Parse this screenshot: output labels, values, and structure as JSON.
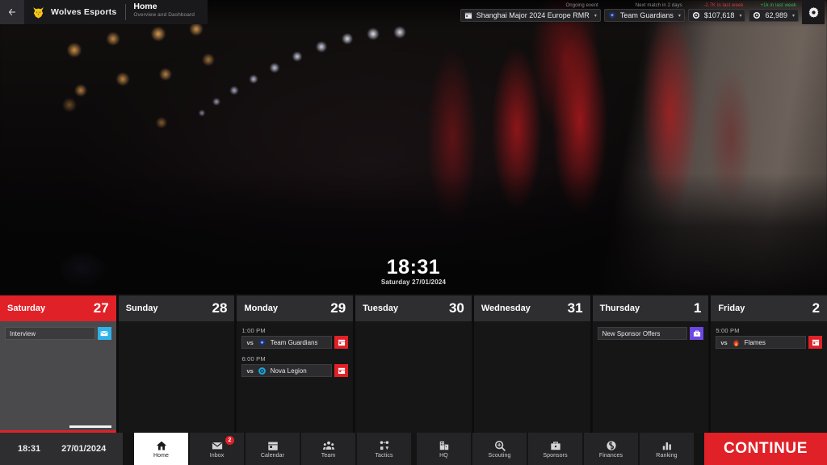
{
  "topbar": {
    "back_icon": "arrow-left-icon",
    "brand": "Wolves Esports",
    "logo_icon": "wolf-head-logo",
    "page_title": "Home",
    "page_subtitle": "Overview and Dashboard",
    "event": {
      "caption": "Ongoing event",
      "icon": "calendar-icon",
      "value": "Shanghai Major 2024 Europe RMR",
      "caret": "▾"
    },
    "next_match": {
      "caption": "Next match in 2 days",
      "icon": "team-guardians-logo",
      "value": "Team Guardians",
      "caret": "▾"
    },
    "money": {
      "caption": "-2.7K in last week",
      "trend": "negative",
      "icon": "coin-icon",
      "value": "$107,618",
      "caret": "▾"
    },
    "fans": {
      "caption": "+1k in last week",
      "trend": "positive",
      "icon": "coin-icon",
      "value": "62,989",
      "caret": "▾"
    },
    "settings_icon": "gear-icon"
  },
  "clock": {
    "time": "18:31",
    "date": "Saturday 27/01/2024"
  },
  "calendar": {
    "days": [
      {
        "name": "Saturday",
        "number": "27",
        "today": true,
        "progress": true,
        "events": [
          {
            "time": "",
            "vs": "",
            "label": "Interview",
            "icon": "",
            "action_icon": "envelope-icon",
            "action_color": "blue"
          }
        ]
      },
      {
        "name": "Sunday",
        "number": "28",
        "today": false,
        "progress": false,
        "events": []
      },
      {
        "name": "Monday",
        "number": "29",
        "today": false,
        "progress": false,
        "events": [
          {
            "time": "1:00 PM",
            "vs": "vs",
            "label": "Team Guardians",
            "icon": "team-guardians-logo",
            "action_icon": "calendar-icon",
            "action_color": "red"
          },
          {
            "time": "6:00 PM",
            "vs": "vs",
            "label": "Nova Legion",
            "icon": "nova-legion-logo",
            "action_icon": "calendar-icon",
            "action_color": "red"
          }
        ]
      },
      {
        "name": "Tuesday",
        "number": "30",
        "today": false,
        "progress": false,
        "events": []
      },
      {
        "name": "Wednesday",
        "number": "31",
        "today": false,
        "progress": false,
        "events": []
      },
      {
        "name": "Thursday",
        "number": "1",
        "today": false,
        "progress": false,
        "events": [
          {
            "time": "",
            "vs": "",
            "label": "New Sponsor Offers",
            "icon": "",
            "action_icon": "briefcase-icon",
            "action_color": "purple"
          }
        ]
      },
      {
        "name": "Friday",
        "number": "2",
        "today": false,
        "progress": false,
        "events": [
          {
            "time": "5:00 PM",
            "vs": "vs",
            "label": "Flames",
            "icon": "flames-logo",
            "action_icon": "calendar-icon",
            "action_color": "red"
          }
        ]
      }
    ]
  },
  "bottom": {
    "time": "18:31",
    "date": "27/01/2024",
    "nav": [
      {
        "label": "Home",
        "icon": "home-icon",
        "active": true,
        "badge": ""
      },
      {
        "label": "Inbox",
        "icon": "envelope-icon",
        "active": false,
        "badge": "2"
      },
      {
        "label": "Calendar",
        "icon": "calendar-icon",
        "active": false,
        "badge": ""
      },
      {
        "label": "Team",
        "icon": "people-icon",
        "active": false,
        "badge": ""
      },
      {
        "label": "Tactics",
        "icon": "tactics-icon",
        "active": false,
        "badge": ""
      },
      {
        "label": "HQ",
        "icon": "building-icon",
        "active": false,
        "badge": ""
      },
      {
        "label": "Scouting",
        "icon": "search-icon",
        "active": false,
        "badge": ""
      },
      {
        "label": "Sponsors",
        "icon": "briefcase-icon",
        "active": false,
        "badge": ""
      },
      {
        "label": "Finances",
        "icon": "coin-icon",
        "active": false,
        "badge": ""
      },
      {
        "label": "Ranking",
        "icon": "bars-icon",
        "active": false,
        "badge": ""
      }
    ],
    "continue_label": "CONTINUE"
  },
  "colors": {
    "accent_red": "#e02128",
    "brand_gold": "#f5c518",
    "blue": "#2fb2e8",
    "purple": "#6d47e0",
    "positive": "#35b45b",
    "negative": "#d9383f"
  }
}
